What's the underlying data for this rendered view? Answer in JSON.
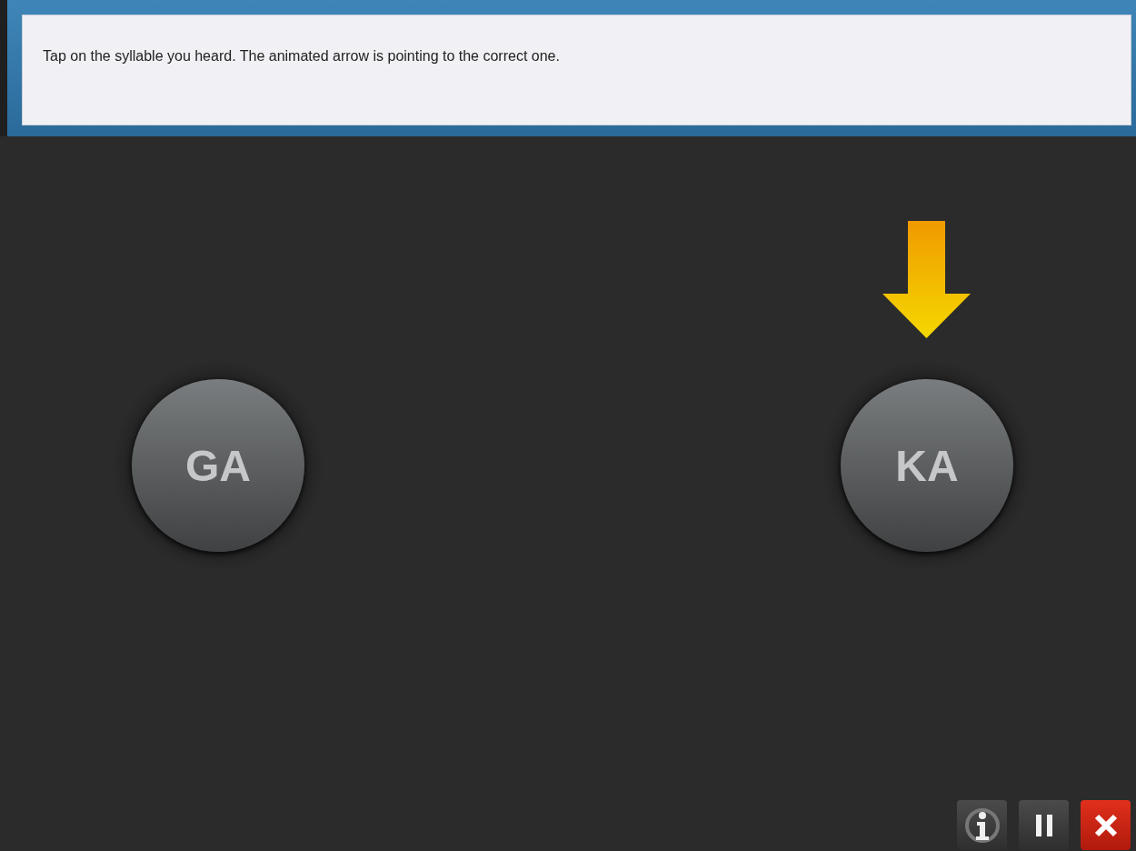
{
  "instruction": {
    "text": "Tap on the syllable you heard.  The animated arrow is pointing to the correct one."
  },
  "syllables": [
    {
      "label": "GA",
      "pointed": false
    },
    {
      "label": "KA",
      "pointed": true
    }
  ],
  "toolbar": [
    {
      "kind": "info"
    },
    {
      "kind": "pause"
    },
    {
      "kind": "close"
    }
  ]
}
